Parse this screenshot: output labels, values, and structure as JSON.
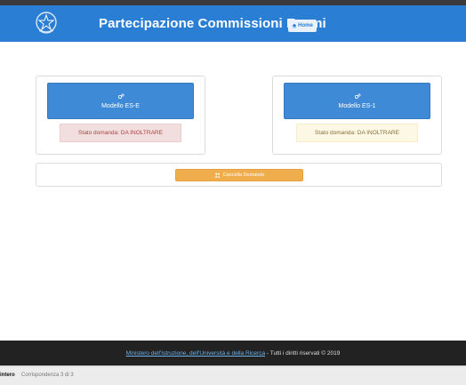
{
  "header": {
    "title": "Partecipazione Commissioni Esami",
    "home_label": "Home"
  },
  "cards": [
    {
      "model_label": "Modello ES-E",
      "status_text": "Stato domanda: DA INOLTRARE",
      "status_color": "#f2dede"
    },
    {
      "model_label": "Modello ES-1",
      "status_text": "Stato domanda: DA INOLTRARE",
      "status_color": "#fcf8e3"
    }
  ],
  "actions": {
    "cancel_label": "Cancella Domande"
  },
  "footer": {
    "ministry_link": "Ministero dell'Istruzione, dell'Università e della Ricerca",
    "rights_text": " - Tutti i diritti riservati © 2019"
  },
  "findbar": {
    "word": "intero",
    "match_count": "Corrispondenza 3 di 3"
  },
  "colors": {
    "header": "#2a7fd4",
    "primary_button": "#3f8ad6",
    "warning_button": "#f0ad4e",
    "footer": "#222222"
  },
  "icons": {
    "emblem": "republic-emblem-icon",
    "home": "home-icon",
    "model": "cogs-icon",
    "cancel": "users-icon"
  }
}
